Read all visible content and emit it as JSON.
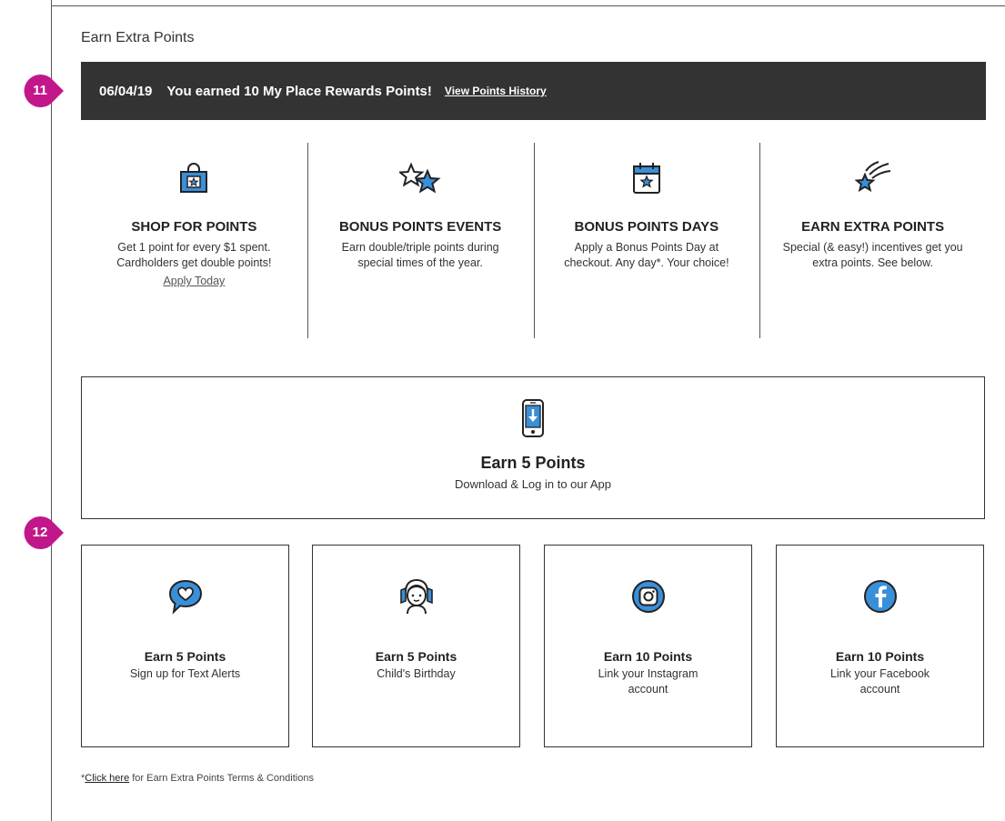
{
  "section_title": "Earn Extra Points",
  "banner": {
    "date": "06/04/19",
    "message_pre": "You earned",
    "points": "10",
    "message_post": "My Place Rewards Points!",
    "link": "View Points History"
  },
  "callouts": [
    "11",
    "12"
  ],
  "features": [
    {
      "icon": "shopping-bag-star-icon",
      "title": "SHOP FOR POINTS",
      "desc": "Get 1 point for every $1 spent. Cardholders get double points!",
      "link": "Apply Today"
    },
    {
      "icon": "double-star-icon",
      "title": "BONUS POINTS EVENTS",
      "desc": "Earn double/triple points during special times of the year."
    },
    {
      "icon": "calendar-star-icon",
      "title": "BONUS POINTS DAYS",
      "desc": "Apply a Bonus Points Day at checkout. Any day*. Your choice!"
    },
    {
      "icon": "shooting-star-icon",
      "title": "EARN EXTRA POINTS",
      "desc": "Special (& easy!) incentives get you extra points. See below."
    }
  ],
  "app_offer": {
    "icon": "phone-download-icon",
    "title": "Earn 5 Points",
    "desc": "Download & Log in to our App"
  },
  "cards": [
    {
      "icon": "chat-heart-icon",
      "title": "Earn 5 Points",
      "desc": "Sign up for Text Alerts"
    },
    {
      "icon": "girl-portrait-icon",
      "title": "Earn 5 Points",
      "desc": "Child's Birthday"
    },
    {
      "icon": "instagram-icon",
      "title": "Earn 10 Points",
      "desc": "Link your Instagram account"
    },
    {
      "icon": "facebook-icon",
      "title": "Earn 10 Points",
      "desc": "Link your Facebook account"
    }
  ],
  "footnote": {
    "star": "*",
    "link": "Click here",
    "text": " for Earn Extra Points Terms & Conditions"
  },
  "colors": {
    "banner_bg": "#333333",
    "callout": "#c2178a",
    "icon_blue": "#3a8fd9"
  }
}
